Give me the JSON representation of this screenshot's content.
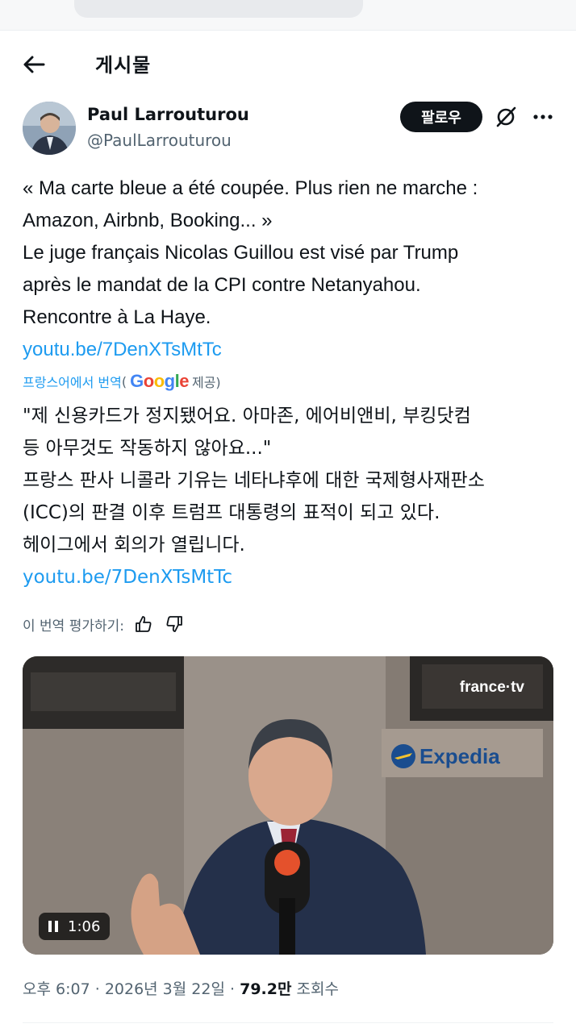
{
  "header": {
    "title": "게시물"
  },
  "author": {
    "name": "Paul Larrouturou",
    "handle": "@PaulLarrouturou",
    "follow_label": "팔로우"
  },
  "post": {
    "lines": [
      "« Ma carte bleue a été coupée. Plus rien ne marche :",
      "Amazon, Airbnb, Booking... »",
      "Le juge français Nicolas Guillou est visé par Trump",
      "après le mandat de la CPI contre Netanyahou.",
      "Rencontre à La Haye."
    ],
    "link": "youtu.be/7DenXTsMtTc"
  },
  "translation": {
    "source_label": "프랑스어에서 번역",
    "provider": "Google",
    "provider_suffix": "제공)",
    "lines": [
      "\"제 신용카드가 정지됐어요. 아마존, 에어비앤비, 부킹닷컴",
      "등 아무것도 작동하지 않아요...\"",
      "프랑스 판사 니콜라 기유는 네타냐후에 대한 국제형사재판소",
      "(ICC)의 판결 이후 트럼프 대통령의 표적이 되고 있다.",
      "헤이그에서 회의가 열립니다."
    ],
    "link": "youtu.be/7DenXTsMtTc",
    "rate_label": "이 번역 평가하기:"
  },
  "media": {
    "duration": "1:06",
    "channel_logo": "france·tv",
    "sign_text": "Expedia"
  },
  "meta": {
    "time": "오후 6:07",
    "date": "2026년 3월 22일",
    "views_count": "79.2만",
    "views_label": "조회수"
  },
  "colors": {
    "link": "#1d9bf0",
    "text": "#0f1419",
    "secondary": "#536471",
    "follow_bg": "#0f1419"
  },
  "icons": [
    "back-arrow-icon",
    "grok-icon",
    "more-icon",
    "thumbs-up-icon",
    "thumbs-down-icon",
    "pause-icon"
  ]
}
